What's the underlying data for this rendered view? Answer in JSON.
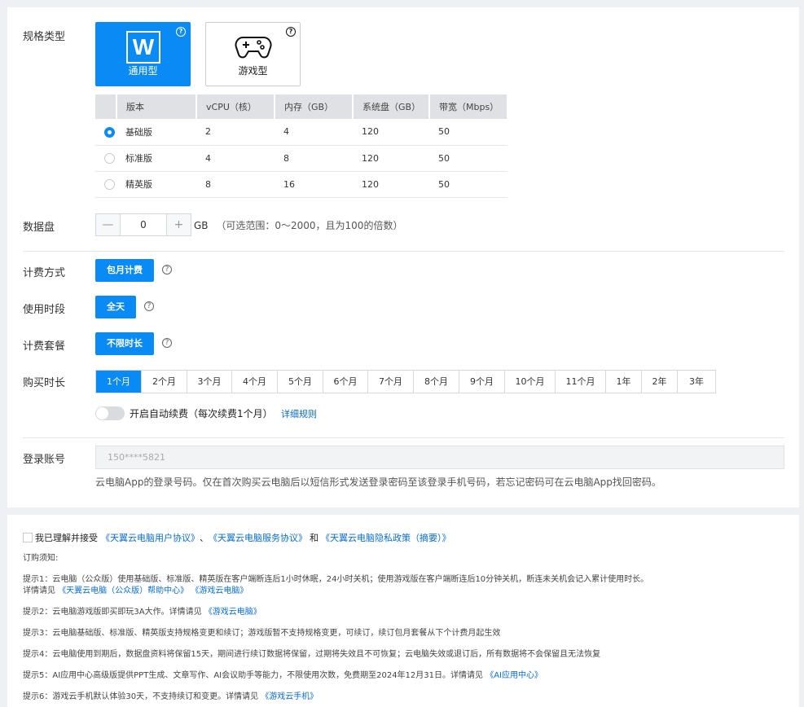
{
  "spec": {
    "label": "规格类型",
    "types": [
      {
        "name": "通用型",
        "active": true,
        "icon": "w-logo-icon",
        "glyph": "W"
      },
      {
        "name": "游戏型",
        "active": false,
        "icon": "gamepad-icon"
      }
    ],
    "help_glyph": "?",
    "table": {
      "headers": [
        "",
        "版本",
        "vCPU（核）",
        "内存（GB）",
        "系统盘（GB）",
        "带宽（Mbps）"
      ],
      "rows": [
        {
          "selected": true,
          "cells": [
            "基础版",
            "2",
            "4",
            "120",
            "50"
          ]
        },
        {
          "selected": false,
          "cells": [
            "标准版",
            "4",
            "8",
            "120",
            "50"
          ]
        },
        {
          "selected": false,
          "cells": [
            "精英版",
            "8",
            "16",
            "120",
            "50"
          ]
        }
      ]
    }
  },
  "disk": {
    "label": "数据盘",
    "minus": "—",
    "plus": "+",
    "value": "0",
    "unit": "GB",
    "hint": "（可选范围：0～2000，且为100的倍数）"
  },
  "billing": {
    "method_label": "计费方式",
    "method_value": "包月计费",
    "period_label": "使用时段",
    "period_value": "全天",
    "package_label": "计费套餐",
    "package_value": "不限时长",
    "help_glyph": "?"
  },
  "duration": {
    "label": "购买时长",
    "options": [
      "1个月",
      "2个月",
      "3个月",
      "4个月",
      "5个月",
      "6个月",
      "7个月",
      "8个月",
      "9个月",
      "10个月",
      "11个月",
      "1年",
      "2年",
      "3年"
    ],
    "selected_index": 0,
    "auto_renew_text": "开启自动续费（每次续费1个月）",
    "auto_renew_on": false,
    "rules_link": "详细规则"
  },
  "account": {
    "label": "登录账号",
    "value": "150****5821",
    "note": "云电脑App的登录号码。仅在首次购买云电脑后以短信形式发送登录密码至该登录手机号码，若忘记密码可在云电脑App找回密码。"
  },
  "agreement": {
    "prefix": "我已理解并接受",
    "link1": "《天翼云电脑用户协议》",
    "sep": "、",
    "link2": "《天翼云电脑服务协议》",
    "and": "和",
    "link3": "《天翼云电脑隐私政策（摘要）》"
  },
  "notes": {
    "title": "订购须知:",
    "tip1": "提示1：云电脑（公众版）使用基础版、标准版、精英版在客户端断连后1小时休眠，24小时关机；使用游戏版在客户端断连后10分钟关机，断连未关机会记入累计使用时长。",
    "tip1_more": "详情请见",
    "tip1_link1": "《天翼云电脑（公众版）帮助中心》",
    "tip1_link2": "《游戏云电脑》",
    "tip2": "提示2：云电脑游戏版即买即玩3A大作。详情请见",
    "tip2_link": "《游戏云电脑》",
    "tip3": "提示3：云电脑基础版、标准版、精英版支持规格变更和续订；游戏版暂不支持规格变更，可续订，续订包月套餐从下个计费月起生效",
    "tip4": "提示4：云电脑使用到期后，数据盘资料将保留15天，期间进行续订数据将保留，过期将失效且不可恢复；云电脑失效或退订后，所有数据将不会保留且无法恢复",
    "tip5": "提示5：AI应用中心高级版提供PPT生成、文章写作、AI会议助手等能力，不限使用次数，免费期至2024年12月31日。详情请见",
    "tip5_link": "《AI应用中心》",
    "tip6": "提示6：游戏云手机默认体验30天，不支持续订和变更。详情请见",
    "tip6_link": "《游戏云手机》"
  }
}
